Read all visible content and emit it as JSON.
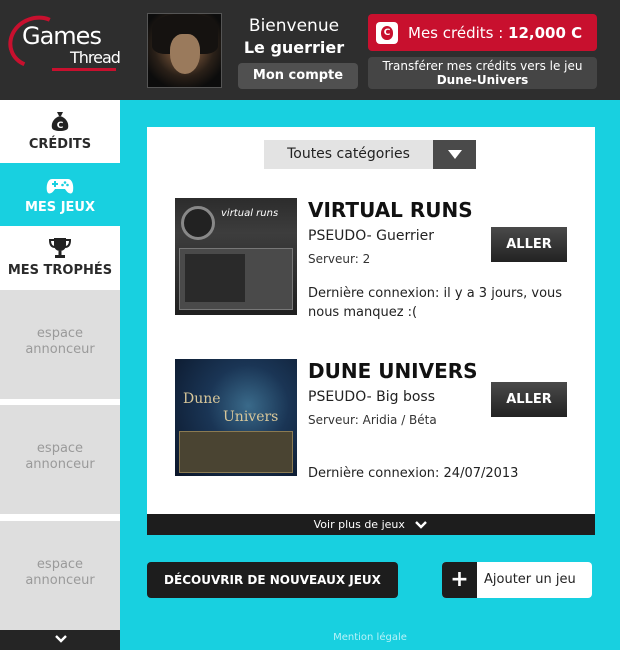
{
  "header": {
    "logo_line1": "Games",
    "logo_line2": "Thread",
    "welcome": "Bienvenue",
    "username": "Le guerrier",
    "account_button": "Mon compte",
    "credits_label": "Mes crédits : ",
    "credits_value": "12,000 C",
    "credits_icon_letter": "C",
    "transfer_line1": "Transférer mes crédits vers le jeu",
    "transfer_line2": "Dune-Univers"
  },
  "sidebar": {
    "items": [
      {
        "label": "CRÉDITS",
        "icon": "money-bag-icon"
      },
      {
        "label": "MES JEUX",
        "icon": "gamepad-icon"
      },
      {
        "label": "MES TROPHÉS",
        "icon": "trophy-icon"
      }
    ],
    "ads": [
      {
        "line1": "espace",
        "line2": "annonceur"
      },
      {
        "line1": "espace",
        "line2": "annonceur"
      },
      {
        "line1": "espace",
        "line2": "annonceur"
      }
    ]
  },
  "main": {
    "category_select": "Toutes catégories",
    "games": [
      {
        "title": "VIRTUAL RUNS",
        "pseudo": "PSEUDO- Guerrier",
        "server": "Serveur: 2",
        "last_login": "Dernière connexion: il y a 3 jours, vous nous manquez :(",
        "button": "ALLER",
        "thumb_text": "virtual runs"
      },
      {
        "title": "DUNE UNIVERS",
        "pseudo": "PSEUDO- Big boss",
        "server": "Serveur: Aridia / Béta",
        "last_login": "Dernière connexion: 24/07/2013",
        "button": "ALLER",
        "thumb_text1": "Dune",
        "thumb_text2": "Univers"
      }
    ],
    "see_more": "Voir plus de jeux",
    "discover_button": "DÉCOUVRIR DE NOUVEAUX JEUX",
    "add_button": "Ajouter un jeu",
    "add_symbol": "+",
    "legal": "Mention légale"
  },
  "colors": {
    "accent_cyan": "#18d0e0",
    "brand_red": "#c8102e",
    "dark": "#1d1d1d"
  }
}
